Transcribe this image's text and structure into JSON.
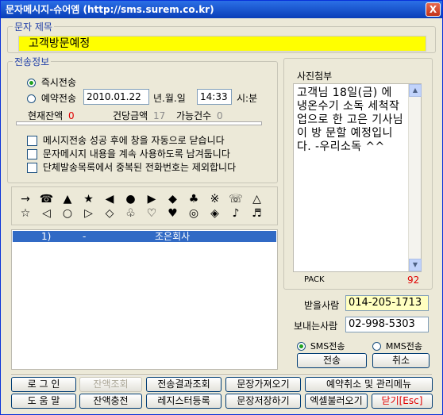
{
  "window": {
    "title": "문자메시지-슈어엠 (http://sms.surem.co.kr)",
    "close_glyph": "X"
  },
  "subject": {
    "legend": "문자 제목",
    "value": "고객방문예정"
  },
  "send_info": {
    "legend": "전송정보",
    "immediate_label": "즉시전송",
    "reserve_label": "예약전송",
    "reserve_date": "2010.01.22",
    "date_unit": "년.월.일",
    "reserve_time": "14:33",
    "time_unit": "시:분",
    "balance_label": "현재잔액",
    "balance_value": "0",
    "unit_price_label": "건당금액",
    "unit_price_value": "17",
    "available_label": "가능건수",
    "available_value": "0",
    "options": [
      "메시지전송 성공 후에 창을 자동으로 닫습니다",
      "문자메시지 내용을 계속 사용하도록 남겨둡니다",
      "단체발송목록에서 중복된 전화번호는 제외합니다"
    ]
  },
  "symbols_row1": [
    "→",
    "☎",
    "▲",
    "★",
    "◀",
    "●",
    "▶",
    "◆",
    "♣",
    "※",
    "☏",
    "△"
  ],
  "symbols_row2": [
    "☆",
    "◁",
    "○",
    "▷",
    "◇",
    "♧",
    "♡",
    "♥",
    "◎",
    "◈",
    "♪",
    "♬"
  ],
  "recipients": {
    "rows": [
      {
        "index": "1)",
        "sep": "-",
        "name": "조은회사"
      }
    ]
  },
  "photo": {
    "legend": "사진첨부",
    "message": "고객님 18일(금) 에 냉온수기 소독 세척작업으로 한 고은 기사님이 방 문할 예정입니다. -우리소독 ^^",
    "type_label": "PACK",
    "char_count": "92"
  },
  "to_label": "받을사람",
  "to_value": "014-205-1713",
  "from_label": "보내는사람",
  "from_value": "02-998-5303",
  "send_type": {
    "sms_label": "SMS전송",
    "mms_label": "MMS전송"
  },
  "actions": {
    "send": "전송",
    "cancel": "취소"
  },
  "bottom": {
    "login": "로 그 인",
    "balance_check": "잔액조회",
    "result_check": "전송결과조회",
    "load_sentence": "문장가져오기",
    "reserve_cancel": "예약취소 및 관리메뉴",
    "help": "도 움 말",
    "recharge": "잔액충전",
    "registry": "레지스터등록",
    "save_sentence": "문장저장하기",
    "excel_load": "엑셀불러오기",
    "close": "닫기[Esc]"
  },
  "colors": {
    "title_bar": "#0a3fb8",
    "subject_bg": "#ffff00",
    "selection": "#316ac5",
    "accent_red": "#e00000"
  }
}
